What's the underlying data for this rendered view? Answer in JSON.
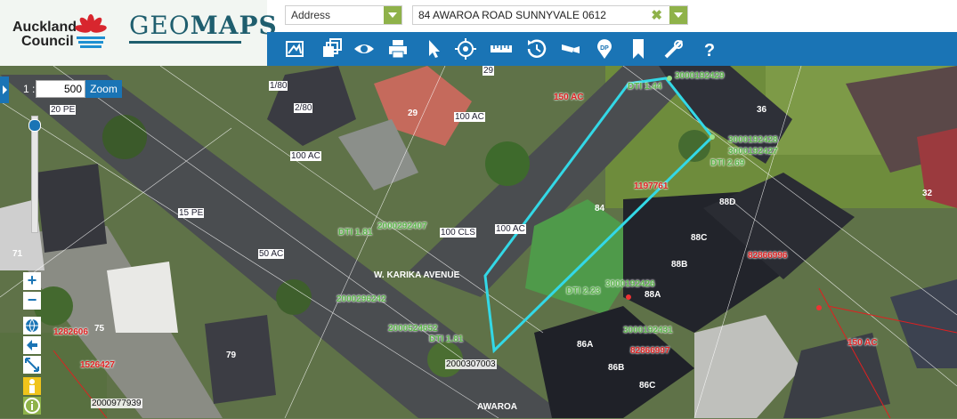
{
  "header": {
    "council_line1": "Auckland",
    "council_line2": "Council",
    "app_name_light": "GEO",
    "app_name_bold": "MAPS",
    "search_type": "Address",
    "search_value": "84 AWAROA ROAD SUNNYVALE 0612",
    "clear_symbol": "✖"
  },
  "toolbar": {
    "tools": [
      "legend-icon",
      "layers-icon",
      "view-icon",
      "print-icon",
      "select-icon",
      "locate-icon",
      "measure-icon",
      "history-icon",
      "camera-icon",
      "dp-icon",
      "bookmark-icon",
      "tools-icon",
      "help-icon"
    ],
    "dp_label": "DP",
    "help_label": "?"
  },
  "map_controls": {
    "scale_prefix": "1 :",
    "scale_value": "500",
    "zoom_label": "Zoom",
    "zoom_in": "+",
    "zoom_out": "−"
  },
  "labels": {
    "dti_1": "DTI 1.44",
    "dti_2": "DTI 2.69",
    "dti_3": "DTI 1.81",
    "dti_4": "DTI 2.23",
    "dti_5": "DTI 1.81",
    "p1": "3000192429",
    "p2": "3000192428",
    "p3": "3000192427",
    "p4": "2000292407",
    "p5": "3000192426",
    "p6": "2000296242",
    "p7": "2000524652",
    "p8": "2000307003",
    "p9": "2000977939",
    "p10": "3000192431",
    "r1": "1197761",
    "r2": "82866996",
    "r3": "82866997",
    "r4": "1282606",
    "r5": "1526427",
    "w1": "84",
    "w2": "88D",
    "w3": "88C",
    "w4": "88B",
    "w5": "88A",
    "w6": "86A",
    "w7": "86B",
    "w8": "86C",
    "w9": "36",
    "w10": "32",
    "w11": "29",
    "w12": "75",
    "w13": "71",
    "w14": "79",
    "b1": "1/80",
    "b2": "2/80",
    "b3": "100 AC",
    "b4": "100 CLS",
    "b5": "50 AC",
    "b6": "100 AC",
    "b7": "15 PE",
    "b8": "150 AC",
    "b9": "150 AC",
    "b10": "20 PE",
    "b11": "100 AC",
    "b12": "29",
    "road1": "W. KARIKA AVENUE",
    "road2": "AWAROA"
  }
}
